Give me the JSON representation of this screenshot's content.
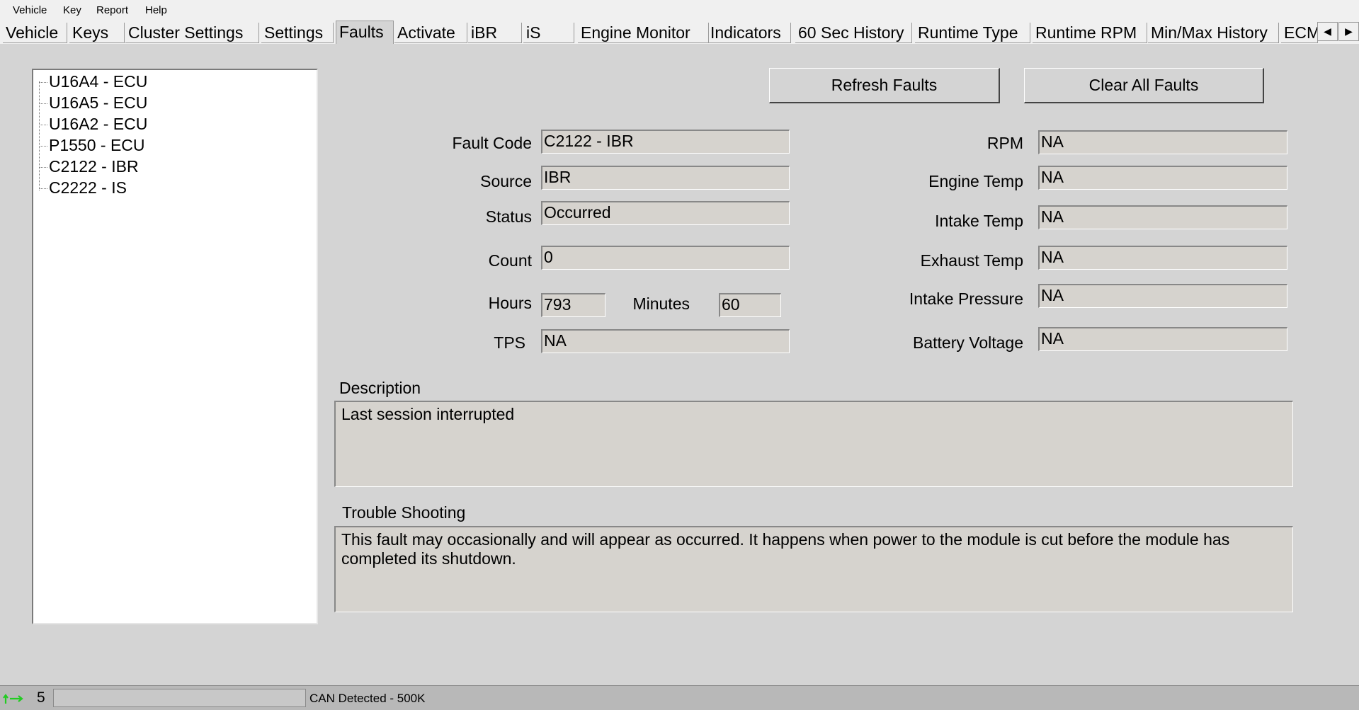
{
  "menu": [
    "Vehicle",
    "Key",
    "Report",
    "Help"
  ],
  "tabs": [
    "Vehicle",
    "Keys",
    "Cluster Settings",
    "Settings",
    "Faults",
    "Activate",
    "iBR",
    "iS",
    "Engine Monitor",
    "Indicators",
    "60 Sec History",
    "Runtime Type",
    "Runtime RPM",
    "Min/Max History",
    "ECM"
  ],
  "active_tab": "Faults",
  "tab_scroll": {
    "left_icon": "triangle-left-icon",
    "left": "◀",
    "right_icon": "triangle-right-icon",
    "right": "▶"
  },
  "fault_list": [
    "U16A4 - ECU",
    "U16A5 - ECU",
    "U16A2 - ECU",
    "P1550 - ECU",
    "C2122 - IBR",
    "C2222 - IS"
  ],
  "buttons": {
    "refresh": "Refresh Faults",
    "clear": "Clear All Faults"
  },
  "fields": {
    "fault_code": {
      "label": "Fault Code",
      "value": "C2122 - IBR"
    },
    "source": {
      "label": "Source",
      "value": "IBR"
    },
    "status": {
      "label": "Status",
      "value": "Occurred"
    },
    "count": {
      "label": "Count",
      "value": "0"
    },
    "hours": {
      "label": "Hours",
      "value": "793"
    },
    "minutes": {
      "label": "Minutes",
      "value": "60"
    },
    "tps": {
      "label": "TPS",
      "value": "NA"
    },
    "rpm": {
      "label": "RPM",
      "value": "NA"
    },
    "engine_temp": {
      "label": "Engine Temp",
      "value": "NA"
    },
    "intake_temp": {
      "label": "Intake Temp",
      "value": "NA"
    },
    "exhaust_temp": {
      "label": "Exhaust Temp",
      "value": "NA"
    },
    "intake_pressure": {
      "label": "Intake Pressure",
      "value": "NA"
    },
    "battery_voltage": {
      "label": "Battery Voltage",
      "value": "NA"
    }
  },
  "description": {
    "label": "Description",
    "text": "Last session interrupted"
  },
  "trouble_shooting": {
    "label": "Trouble Shooting",
    "text": "This fault may occasionally and will appear as occurred. It happens when power to the module is cut before the module has completed its shutdown."
  },
  "status_bar": {
    "icon": "connection-arrows-icon",
    "count": "5",
    "text": "CAN Detected - 500K",
    "icon_color": "#22cc22"
  }
}
